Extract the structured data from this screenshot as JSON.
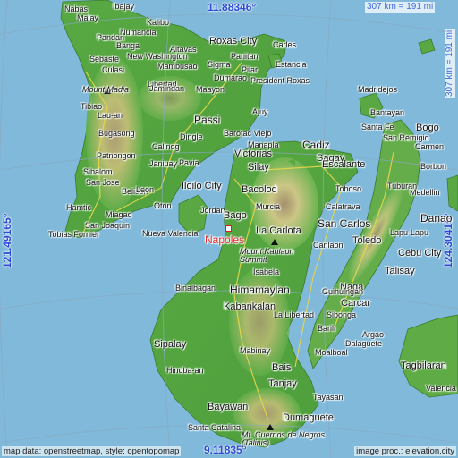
{
  "coordinates": {
    "lat_top": "11.88346°",
    "lat_bottom": "9.11835°",
    "lon_left": "121.49165°",
    "lon_right": "124.30415°"
  },
  "scale": {
    "horizontal": "307 km = 191 mi",
    "vertical": "307 km = 191 mi"
  },
  "target": {
    "name": "Napoles",
    "marker_color": "#d42020"
  },
  "peaks": [
    {
      "name": "Mount Madja"
    },
    {
      "name": "Mount Kanlaon Summit"
    },
    {
      "name": "Mt. Cuernos de Negros (Talinis)"
    }
  ],
  "places": [
    "Nabas",
    "Ibajay",
    "Kalibo",
    "Numancia",
    "New Washington",
    "Banga",
    "Altavas",
    "Malay",
    "Culasi",
    "Pandan",
    "Sebaste",
    "Mambusao",
    "Roxas City",
    "Carles",
    "Panitan",
    "Estancia",
    "Pilar",
    "President Roxas",
    "Libertad",
    "Sigma",
    "Dumarao",
    "Jamindan",
    "Maayon",
    "Tibiao",
    "Lau-an",
    "Bugasong",
    "Dingle",
    "Passi",
    "Ajuy",
    "Barotac Viejo",
    "Manapla",
    "Patnongon",
    "Janiuay",
    "Pavia",
    "Calinog",
    "Victorias",
    "Cadiz",
    "Sagay",
    "Escalante",
    "Silay",
    "Bacolod",
    "Murcia",
    "Belison",
    "Sibalom",
    "San Jose",
    "Leon",
    "Iloilo City",
    "Jordan",
    "Oton",
    "Hamtic",
    "Miagao",
    "Tobias Fornier",
    "San Joaquin",
    "Nueva Valencia",
    "Bago",
    "La Carlota",
    "Isabela",
    "Binalbagan",
    "Himamaylan",
    "Kabankalan",
    "La Libertad",
    "Sipalay",
    "Hinoba-an",
    "Mabinay",
    "Bais",
    "Tanjay",
    "Bayawan",
    "Dumaguete",
    "Santa Catalina",
    "Madridejos",
    "Bantayan",
    "Santa Fe",
    "Bogo",
    "San Remigio",
    "Tuburan",
    "Toledo",
    "Cebu City",
    "Lapu-Lapu",
    "Talisay",
    "Naga",
    "Carcar",
    "Sibonga",
    "Barili",
    "Dalaguete",
    "Argao",
    "Moalboal",
    "Danao",
    "Calatrava",
    "Toboso",
    "San Carlos",
    "Tagbilaran",
    "Valencia",
    "Guihulngan",
    "Tayasan",
    "Canlaon",
    "Carmen",
    "Borbon",
    "Medellin"
  ],
  "credits": {
    "left": "map data: openstreetmap, style: opentopomap",
    "right": "image proc.: elevation.city"
  }
}
